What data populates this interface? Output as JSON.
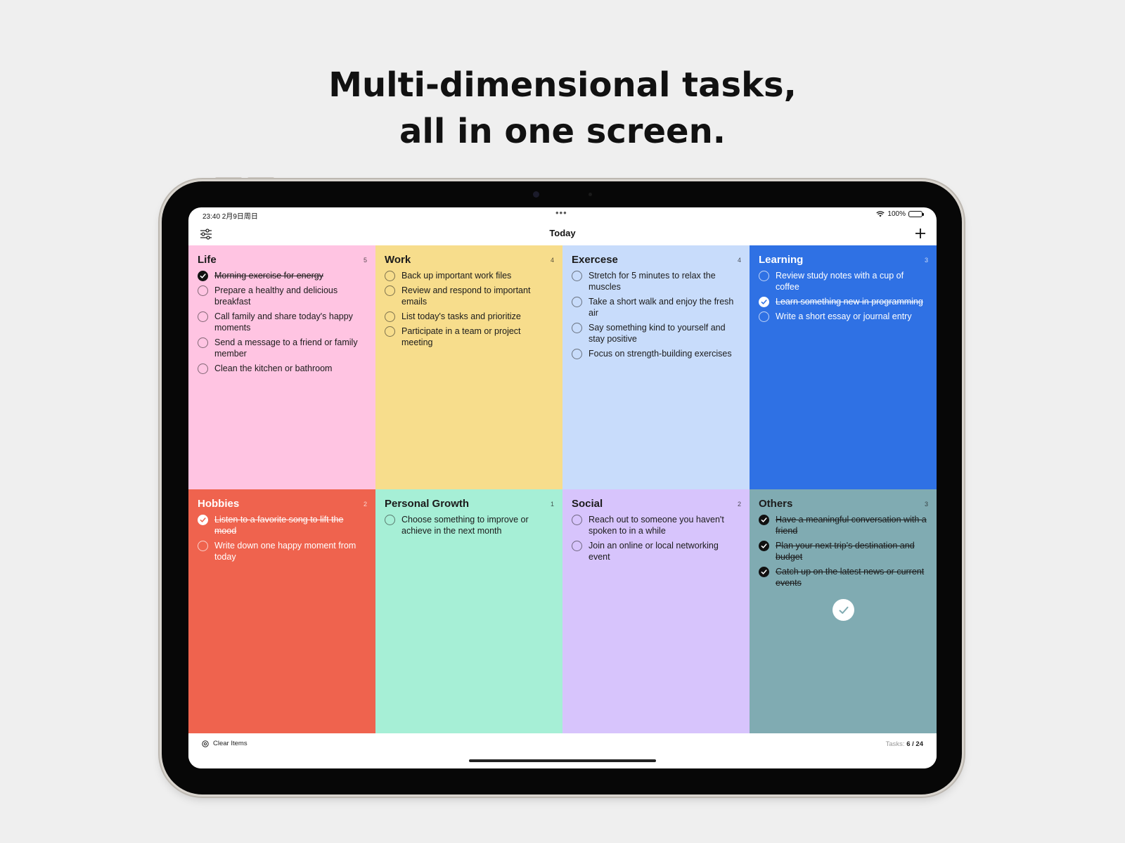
{
  "headline": {
    "line1": "Multi-dimensional tasks,",
    "line2": "all in one screen."
  },
  "status_bar": {
    "time_date": "23:40  2月9日周日",
    "battery": "100%"
  },
  "navbar": {
    "title": "Today",
    "filter_icon": "sliders-icon",
    "add_icon": "plus-icon"
  },
  "panels": [
    {
      "title": "Life",
      "count": "5",
      "color": "#ffc4e2",
      "text_theme": "dark",
      "tasks": [
        {
          "text": "Morning exercise for energy",
          "done": true
        },
        {
          "text": "Prepare a healthy and delicious breakfast",
          "done": false
        },
        {
          "text": "Call family and share today's happy moments",
          "done": false
        },
        {
          "text": "Send a message to a friend or family member",
          "done": false
        },
        {
          "text": "Clean the kitchen or bathroom",
          "done": false
        }
      ]
    },
    {
      "title": "Work",
      "count": "4",
      "color": "#f7dd8c",
      "text_theme": "dark",
      "tasks": [
        {
          "text": "Back up important work files",
          "done": false
        },
        {
          "text": "Review and respond to important emails",
          "done": false
        },
        {
          "text": "List today's tasks and prioritize",
          "done": false
        },
        {
          "text": "Participate in a team or project meeting",
          "done": false
        }
      ]
    },
    {
      "title": "Exercese",
      "count": "4",
      "color": "#c8dcfb",
      "text_theme": "dark",
      "tasks": [
        {
          "text": "Stretch for 5 minutes to relax the muscles",
          "done": false
        },
        {
          "text": "Take a short walk and enjoy the fresh air",
          "done": false
        },
        {
          "text": "Say something kind to yourself and stay positive",
          "done": false
        },
        {
          "text": "Focus on strength-building exercises",
          "done": false
        }
      ]
    },
    {
      "title": "Learning",
      "count": "3",
      "color": "#2f71e4",
      "text_theme": "light",
      "tasks": [
        {
          "text": "Review study notes with a cup of coffee",
          "done": false
        },
        {
          "text": "Learn something new in programming",
          "done": true
        },
        {
          "text": "Write a short essay or journal entry",
          "done": false
        }
      ]
    },
    {
      "title": "Hobbies",
      "count": "2",
      "color": "#ef634e",
      "text_theme": "light",
      "tasks": [
        {
          "text": "Listen to a favorite song to lift the mood",
          "done": true
        },
        {
          "text": "Write down one happy moment from today",
          "done": false
        }
      ]
    },
    {
      "title": "Personal Growth",
      "count": "1",
      "color": "#a6efd6",
      "text_theme": "dark",
      "tasks": [
        {
          "text": "Choose something to improve or achieve in the next month",
          "done": false
        }
      ]
    },
    {
      "title": "Social",
      "count": "2",
      "color": "#d7c4fc",
      "text_theme": "dark",
      "tasks": [
        {
          "text": "Reach out to someone you haven't spoken to in a while",
          "done": false
        },
        {
          "text": "Join an online or local networking event",
          "done": false
        }
      ]
    },
    {
      "title": "Others",
      "count": "3",
      "color": "#80abb2",
      "text_theme": "dark",
      "all_done_icon": "check-circle-icon",
      "tasks": [
        {
          "text": "Have a meaningful conversation with a friend",
          "done": true
        },
        {
          "text": "Plan your next trip's destination and budget",
          "done": true
        },
        {
          "text": "Catch up on the latest news or current events",
          "done": true
        }
      ]
    }
  ],
  "bottom_bar": {
    "clear_label": "Clear Items",
    "tasks_label": "Tasks:",
    "tasks_value": "6 / 24"
  }
}
